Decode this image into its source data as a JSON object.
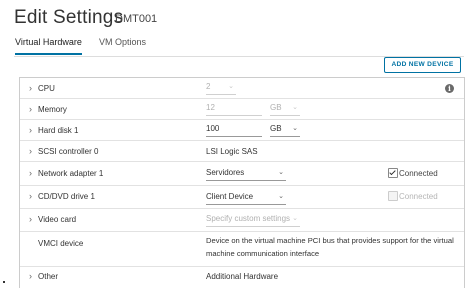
{
  "header": {
    "title": "Edit Settings",
    "vm_name": "DMT001"
  },
  "tabs": [
    {
      "label": "Virtual Hardware",
      "active": true
    },
    {
      "label": "VM Options",
      "active": false
    }
  ],
  "toolbar": {
    "add_device_label": "ADD NEW DEVICE"
  },
  "hardware": {
    "cpu": {
      "label": "CPU",
      "value": "2"
    },
    "memory": {
      "label": "Memory",
      "value": "12",
      "unit": "GB"
    },
    "hard_disk": {
      "label": "Hard disk 1",
      "value": "100",
      "unit": "GB"
    },
    "scsi": {
      "label": "SCSI controller 0",
      "value": "LSI Logic SAS"
    },
    "network": {
      "label": "Network adapter 1",
      "value": "Servidores",
      "connected_label": "Connected"
    },
    "cddvd": {
      "label": "CD/DVD drive 1",
      "value": "Client Device",
      "connected_label": "Connected"
    },
    "video": {
      "label": "Video card",
      "value": "Specify custom settings"
    },
    "vmci": {
      "label": "VMCI device",
      "description": "Device on the virtual machine PCI bus that provides support for the virtual machine communication interface"
    },
    "other": {
      "label": "Other",
      "value": "Additional Hardware"
    }
  },
  "colors": {
    "accent": "#0072a3",
    "disabled_text": "#b0b0b0"
  },
  "icons": {
    "expand": "chevron-right-icon",
    "dropdown": "chevron-down-icon",
    "info": "info-icon"
  }
}
